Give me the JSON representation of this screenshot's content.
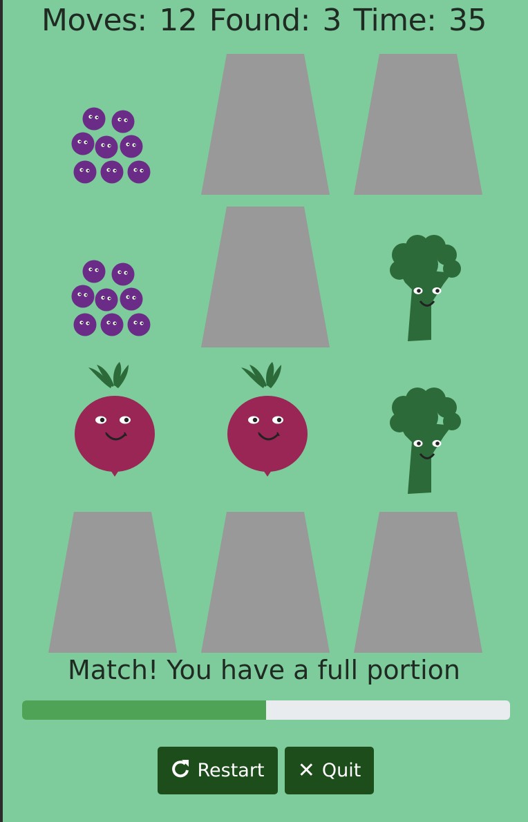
{
  "stats": {
    "moves_label": "Moves:",
    "moves": "12",
    "found_label": "Found:",
    "found": "3",
    "time_label": "Time:",
    "time": "35"
  },
  "cards": [
    {
      "state": "face-up",
      "item": "blueberries"
    },
    {
      "state": "face-down",
      "item": ""
    },
    {
      "state": "face-down",
      "item": ""
    },
    {
      "state": "face-up",
      "item": "blueberries"
    },
    {
      "state": "face-down",
      "item": ""
    },
    {
      "state": "face-up",
      "item": "broccoli"
    },
    {
      "state": "face-up",
      "item": "beetroot"
    },
    {
      "state": "face-up",
      "item": "beetroot"
    },
    {
      "state": "face-up",
      "item": "broccoli"
    },
    {
      "state": "face-down",
      "item": ""
    },
    {
      "state": "face-down",
      "item": ""
    },
    {
      "state": "face-down",
      "item": ""
    }
  ],
  "message": "Match! You have a full portion",
  "progress": {
    "fraction": 0.5
  },
  "buttons": {
    "restart_label": "Restart",
    "restart_icon": "redo-icon",
    "quit_label": "Quit",
    "quit_icon": "close-icon"
  },
  "colors": {
    "background": "#7ecb9c",
    "card_back": "#999999",
    "progress_fill": "#4fa356",
    "progress_track": "#e9ecef",
    "button": "#1e4d1c",
    "blueberry": "#6a2c86",
    "beetroot": "#992655",
    "broccoli": "#2c6b39"
  }
}
